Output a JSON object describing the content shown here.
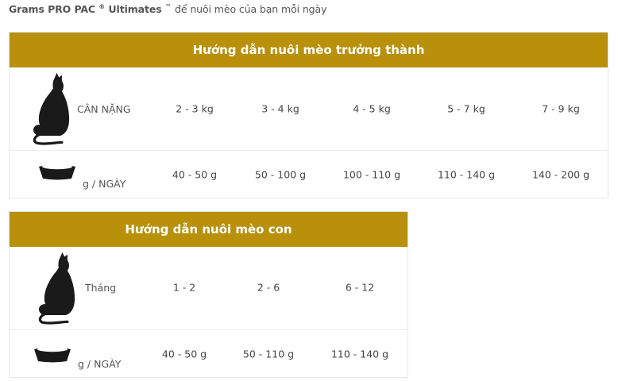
{
  "intro": {
    "brand": "Grams PRO PAC",
    "reg": "®",
    "product": "Ultimates",
    "tm": "™",
    "tail": "để nuôi mèo của bạn mỗi ngày"
  },
  "adult": {
    "title": "Hướng dẫn nuôi mèo trưởng thành",
    "row1_label": "CÂN NẶNG",
    "row1_values": [
      "2 - 3 kg",
      "3 - 4 kg",
      "4 - 5 kg",
      "5 - 7 kg",
      "7 - 9 kg"
    ],
    "row2_label": "g / NGÀY",
    "row2_values": [
      "40 - 50 g",
      "50 - 100 g",
      "100 - 110 g",
      "110 - 140 g",
      "140 - 200 g"
    ]
  },
  "kitten": {
    "title": "Hướng dẫn nuôi mèo con",
    "row1_label": "Tháng",
    "row1_values": [
      "1 - 2",
      "2 - 6",
      "6 - 12"
    ],
    "row2_label": "g / NGÀY",
    "row2_values": [
      "40 - 50 g",
      "50 - 110 g",
      "110 - 140 g"
    ]
  },
  "icons": {
    "cat": "cat-silhouette-icon",
    "bowl": "food-bowl-icon"
  },
  "colors": {
    "header_bg": "#b8900a",
    "header_text": "#ffffff",
    "icon": "#1a1a1a"
  }
}
